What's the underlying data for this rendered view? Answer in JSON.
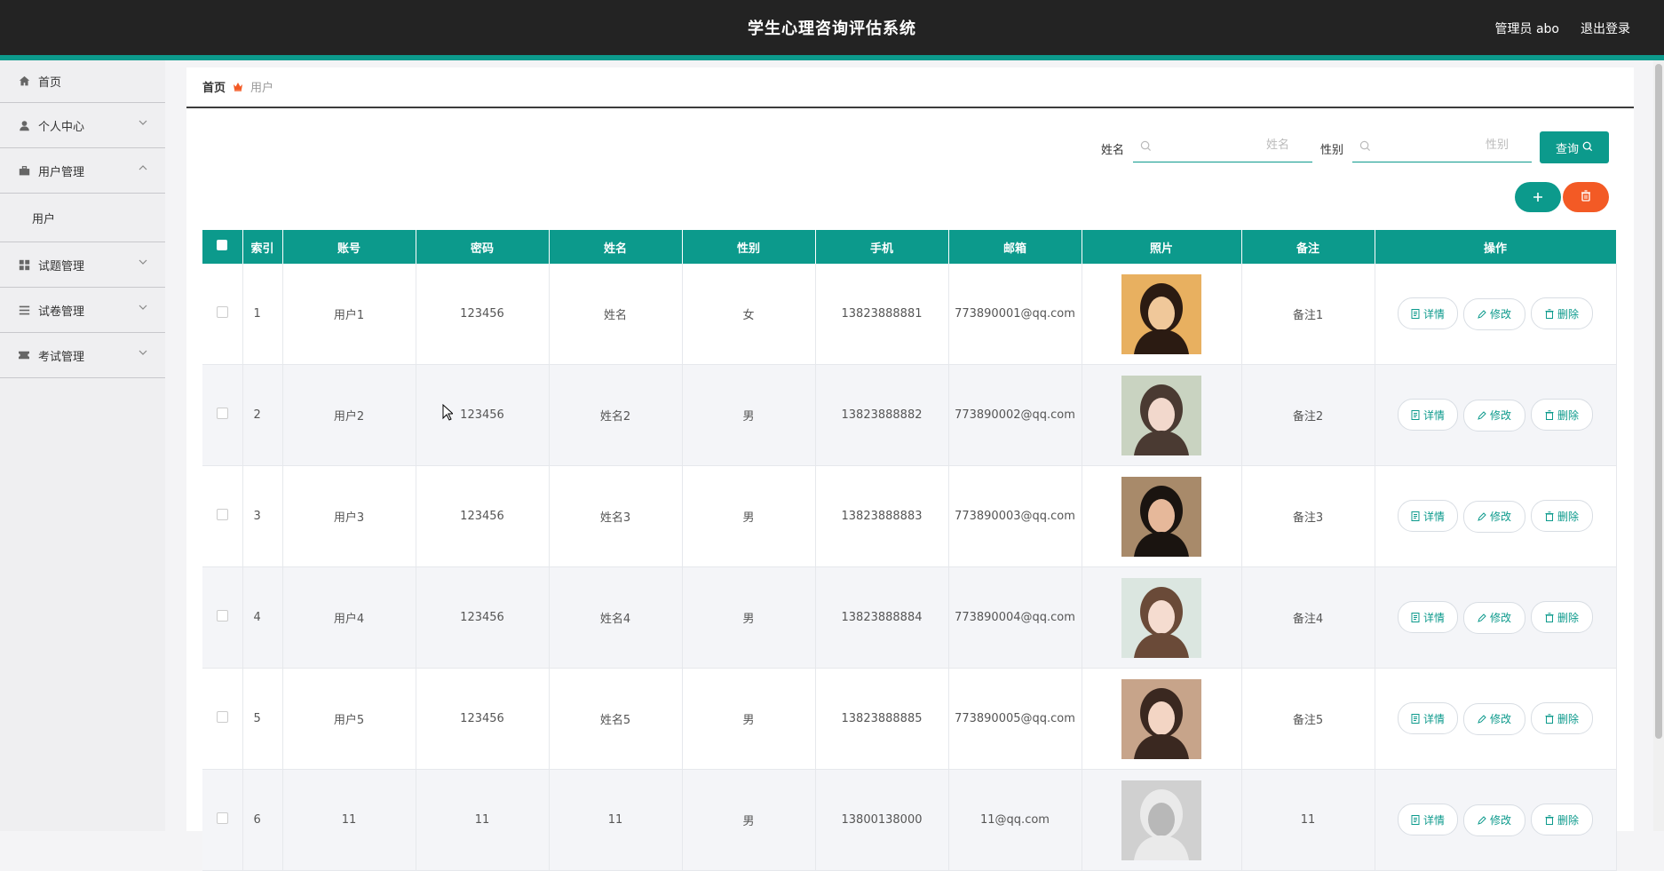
{
  "header": {
    "title": "学生心理咨询评估系统",
    "user_label": "管理员 abo",
    "logout_label": "退出登录"
  },
  "sidebar": {
    "items": [
      {
        "label": "首页",
        "icon": "home-icon"
      },
      {
        "label": "个人中心",
        "icon": "user-icon"
      },
      {
        "label": "用户管理",
        "icon": "briefcase-icon",
        "expanded": true,
        "sub": [
          "用户"
        ]
      },
      {
        "label": "试题管理",
        "icon": "grid-icon"
      },
      {
        "label": "试卷管理",
        "icon": "list-icon"
      },
      {
        "label": "考试管理",
        "icon": "ticket-icon"
      }
    ]
  },
  "breadcrumb": {
    "home": "首页",
    "current": "用户"
  },
  "search": {
    "name_label": "姓名",
    "name_placeholder": "姓名",
    "gender_label": "性别",
    "gender_placeholder": "性别",
    "query_label": "查询"
  },
  "table": {
    "headers": [
      "索引",
      "账号",
      "密码",
      "姓名",
      "性别",
      "手机",
      "邮箱",
      "照片",
      "备注",
      "操作"
    ],
    "actions": {
      "detail": "详情",
      "edit": "修改",
      "delete": "删除"
    },
    "rows": [
      {
        "index": "1",
        "account": "用户1",
        "password": "123456",
        "name": "姓名",
        "gender": "女",
        "phone": "13823888881",
        "email": "773890001@qq.com",
        "note": "备注1",
        "photo": "photo-woman-long-hair"
      },
      {
        "index": "2",
        "account": "用户2",
        "password": "123456",
        "name": "姓名2",
        "gender": "男",
        "phone": "13823888882",
        "email": "773890002@qq.com",
        "note": "备注2",
        "photo": "photo-woman-outdoor"
      },
      {
        "index": "3",
        "account": "用户3",
        "password": "123456",
        "name": "姓名3",
        "gender": "男",
        "phone": "13823888883",
        "email": "773890003@qq.com",
        "note": "备注3",
        "photo": "photo-man-face"
      },
      {
        "index": "4",
        "account": "用户4",
        "password": "123456",
        "name": "姓名4",
        "gender": "男",
        "phone": "13823888884",
        "email": "773890004@qq.com",
        "note": "备注4",
        "photo": "photo-woman-profile"
      },
      {
        "index": "5",
        "account": "用户5",
        "password": "123456",
        "name": "姓名5",
        "gender": "男",
        "phone": "13823888885",
        "email": "773890005@qq.com",
        "note": "备注5",
        "photo": "photo-woman-glasses"
      },
      {
        "index": "6",
        "account": "11",
        "password": "11",
        "name": "11",
        "gender": "男",
        "phone": "13800138000",
        "email": "11@qq.com",
        "note": "11",
        "photo": "photo-man-gray"
      }
    ]
  },
  "colors": {
    "accent": "#0c9a8c",
    "danger": "#f35a25",
    "topbar": "#232323",
    "sidebar": "#efeff1"
  }
}
